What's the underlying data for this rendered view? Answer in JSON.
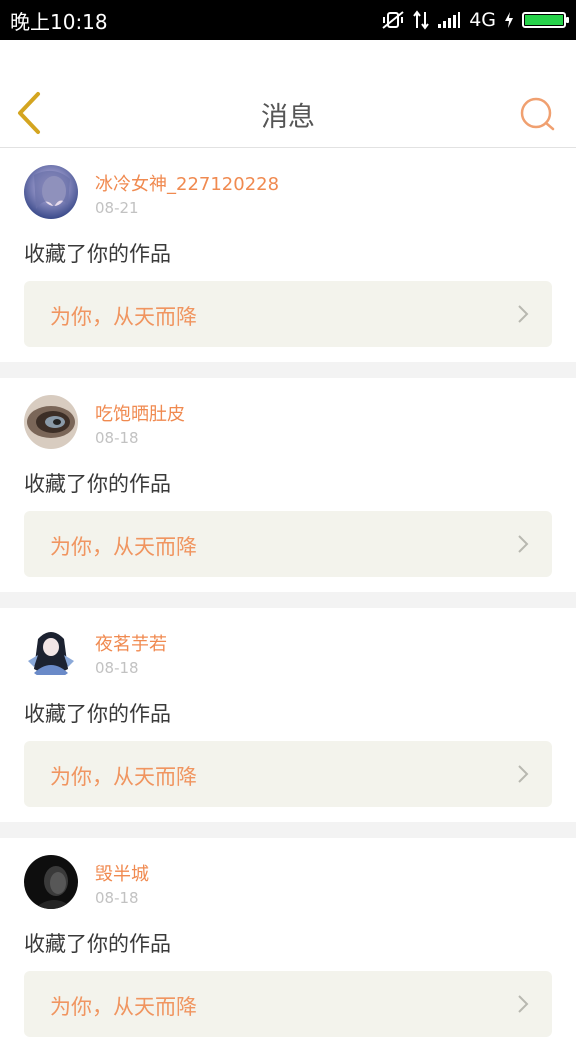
{
  "status_bar": {
    "time": "晚上10:18",
    "network": "4G"
  },
  "header": {
    "title": "消息"
  },
  "messages": [
    {
      "username": "冰冷女神_227120228",
      "date": "08-21",
      "action": "收藏了你的作品",
      "work_title": "为你，从天而降"
    },
    {
      "username": "吃饱晒肚皮",
      "date": "08-18",
      "action": "收藏了你的作品",
      "work_title": "为你，从天而降"
    },
    {
      "username": "夜茗芋若",
      "date": "08-18",
      "action": "收藏了你的作品",
      "work_title": "为你，从天而降"
    },
    {
      "username": "毁半城",
      "date": "08-18",
      "action": "收藏了你的作品",
      "work_title": "为你，从天而降"
    }
  ],
  "colors": {
    "accent": "#f08a50",
    "back_icon": "#d4a520",
    "card_bg": "#f3f3ec"
  },
  "icons": {
    "back": "chevron-left-icon",
    "search": "search-icon",
    "card_arrow": "chevron-right-icon"
  }
}
